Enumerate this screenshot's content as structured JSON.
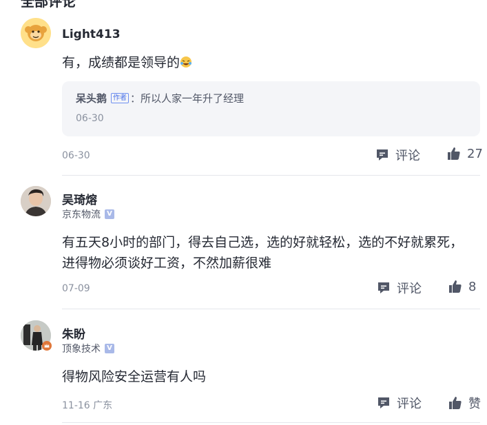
{
  "header": {
    "title": "全部评论"
  },
  "comments": [
    {
      "name": "Light413",
      "company": "",
      "text": "有，成绩都是领导的",
      "emoji": "laughing-tears-emoji",
      "reply": {
        "author": "呆头鹅",
        "tag": "作者",
        "text": "：所以人家一年升了经理",
        "date": "06-30"
      },
      "date": "06-30",
      "comment_label": "评论",
      "like_count": "27"
    },
    {
      "name": "吴琦熔",
      "company": "京东物流",
      "text": "有五天8小时的部门，得去自己选，选的好就轻松，选的不好就累死，进得物必须谈好工资，不然加薪很难",
      "date": "07-09",
      "comment_label": "评论",
      "like_count": "8"
    },
    {
      "name": "朱盼",
      "company": "顶象技术",
      "text": "得物风险安全运营有人吗",
      "date": "11-16 广东",
      "comment_label": "评论",
      "like_count": "赞"
    }
  ],
  "colors": {
    "accent": "#4a72e8",
    "muted": "#8a919f",
    "text": "#252933",
    "reply_bg": "#f4f5f8"
  }
}
